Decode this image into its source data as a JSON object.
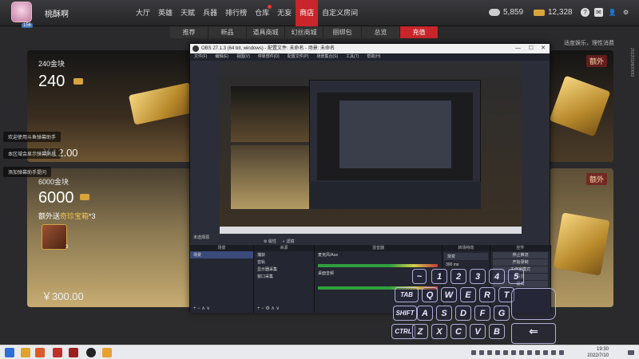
{
  "player": {
    "name": "桃酥啊",
    "level": "156"
  },
  "nav": {
    "items": [
      "大厅",
      "英雄",
      "天赋",
      "兵器",
      "排行榜",
      "仓库",
      "无妄",
      "商店",
      "自定义房间"
    ],
    "active_index": 7
  },
  "resources": {
    "silver": "5,859",
    "gold": "12,328"
  },
  "top_icons": [
    "help-icon",
    "mail-icon",
    "friends-icon",
    "settings-icon"
  ],
  "subtabs": {
    "items": [
      "推荐",
      "新品",
      "道具商城",
      "幻丝商城",
      "丽绑包",
      "总览",
      "充值"
    ],
    "active_index": 6
  },
  "hint": "适度娱乐，理性消费",
  "cards": {
    "c1": {
      "title": "240金块",
      "amount": "240",
      "price": "￥12.00"
    },
    "c2": {
      "title": "6000金块",
      "amount": "6000",
      "bonus_prefix": "额外送",
      "bonus_item": "奇珍宝箱",
      "bonus_count": "*3",
      "chest_count": "3",
      "price": "￥300.00"
    },
    "extra_label": "额外"
  },
  "tooltips": [
    "欢迎使用斗鱼弹幕助手",
    "本区域会显示弹幕消息",
    "添加弹幕助手提问"
  ],
  "obs": {
    "title": "OBS 27.1.3 (64 bit, windows) - 配置文件: 未命名 - 场景: 未命名",
    "menu": [
      "文件(F)",
      "编辑(E)",
      "视图(V)",
      "停靠部件(D)",
      "配置文件(P)",
      "场景集合(S)",
      "工具(T)",
      "帮助(H)"
    ],
    "scene_label": "未选择源",
    "panels": {
      "scenes": {
        "header": "场景",
        "items": [
          "场景"
        ]
      },
      "sources": {
        "header": "来源",
        "items": [
          "捕获",
          "音轨",
          "显示器采集",
          "窗口采集"
        ]
      },
      "mixer": {
        "header": "混音器",
        "tracks": [
          "麦克风/Aux",
          "桌面音频"
        ]
      },
      "transitions": {
        "header": "转场特效",
        "value": "渐变",
        "duration": "300 ms"
      },
      "controls": {
        "header": "控件",
        "buttons": [
          "停止推流",
          "开始录制",
          "工作室模式",
          "设置",
          "退出"
        ]
      }
    },
    "props_label": "属性",
    "filters_label": "滤镜"
  },
  "keyboard": {
    "rows": [
      [
        "1",
        "2",
        "3",
        "4",
        "5"
      ],
      [
        "Q",
        "W",
        "E",
        "R",
        "T"
      ],
      [
        "A",
        "S",
        "D",
        "F",
        "G"
      ],
      [
        "Z",
        "X",
        "C",
        "V",
        "B"
      ]
    ],
    "mods": [
      "TAB",
      "SHIFT",
      "CTRL"
    ]
  },
  "taskbar": {
    "time": "19:30",
    "date": "2022/7/10"
  },
  "side_text": "2022010600683"
}
